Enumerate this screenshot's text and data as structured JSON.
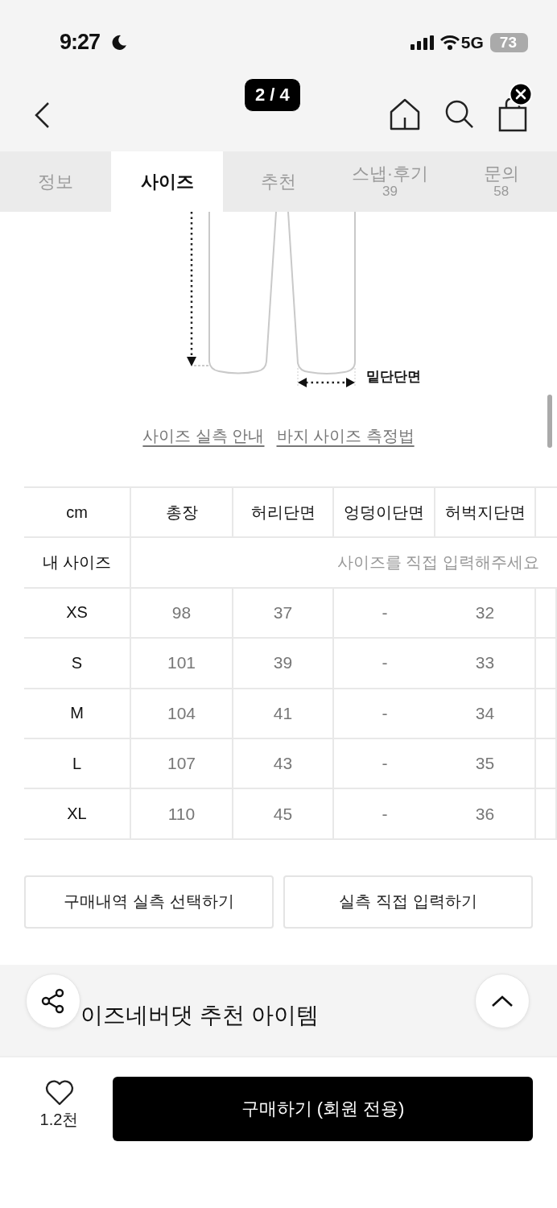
{
  "status_bar": {
    "time": "9:27",
    "network": "5G",
    "battery": "73"
  },
  "header": {
    "page_indicator": "2 / 4"
  },
  "tabs": [
    {
      "label": "정보",
      "selected": false
    },
    {
      "label": "사이즈",
      "selected": true
    },
    {
      "label": "추천",
      "selected": false
    },
    {
      "label": "스냅·후기",
      "count": "39",
      "selected": false
    },
    {
      "label": "문의",
      "count": "58",
      "selected": false
    }
  ],
  "size_guide": {
    "hem_label": "밑단단면",
    "links": [
      "사이즈 실측 안내",
      "바지 사이즈 측정법"
    ]
  },
  "size_table": {
    "columns": [
      "cm",
      "총장",
      "허리단면",
      "엉덩이단면",
      "허벅지단면"
    ],
    "my_size": {
      "label": "내 사이즈",
      "placeholder": "사이즈를 직접 입력해주세요"
    },
    "rows": [
      {
        "size": "XS",
        "values": [
          "98",
          "37",
          "-",
          "32"
        ]
      },
      {
        "size": "S",
        "values": [
          "101",
          "39",
          "-",
          "33"
        ]
      },
      {
        "size": "M",
        "values": [
          "104",
          "41",
          "-",
          "34"
        ]
      },
      {
        "size": "L",
        "values": [
          "107",
          "43",
          "-",
          "35"
        ]
      },
      {
        "size": "XL",
        "values": [
          "110",
          "45",
          "-",
          "36"
        ]
      }
    ]
  },
  "action_buttons": [
    "구매내역 실측 선택하기",
    "실측 직접 입력하기"
  ],
  "recommended": {
    "title": "이즈네버댓 추천 아이템"
  },
  "bottom_bar": {
    "likes": "1.2천",
    "buy_button": "구매하기 (회원 전용)"
  }
}
